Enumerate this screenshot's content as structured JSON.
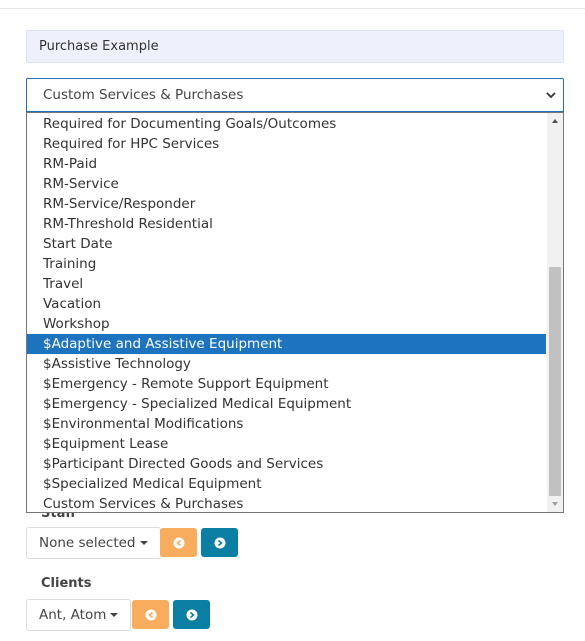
{
  "panel": {
    "title": "Purchase Example"
  },
  "service_select": {
    "selected": "Custom Services & Purchases",
    "options": [
      "Required for Documenting Goals/Outcomes",
      "Required for HPC Services",
      "RM-Paid",
      "RM-Service",
      "RM-Service/Responder",
      "RM-Threshold Residential",
      "Start Date",
      "Training",
      "Travel",
      "Vacation",
      "Workshop",
      "$Adaptive and Assistive Equipment",
      "$Assistive Technology",
      "$Emergency - Remote Support Equipment",
      "$Emergency - Specialized Medical Equipment",
      "$Environmental Modifications",
      "$Equipment Lease",
      "$Participant Directed Goods and Services",
      "$Specialized Medical Equipment",
      "Custom Services & Purchases"
    ],
    "highlighted": "$Adaptive and Assistive Equipment"
  },
  "staff": {
    "label": "Staff",
    "value": "None selected"
  },
  "clients": {
    "label": "Clients",
    "value": "Ant, Atom"
  },
  "icons": {
    "chevron": "chevron-down-icon",
    "remove": "arrow-left-circle-icon",
    "add": "arrow-right-circle-icon"
  },
  "colors": {
    "accent": "#1e73be",
    "orange": "#f7ad5d",
    "teal": "#0b7ea3"
  }
}
